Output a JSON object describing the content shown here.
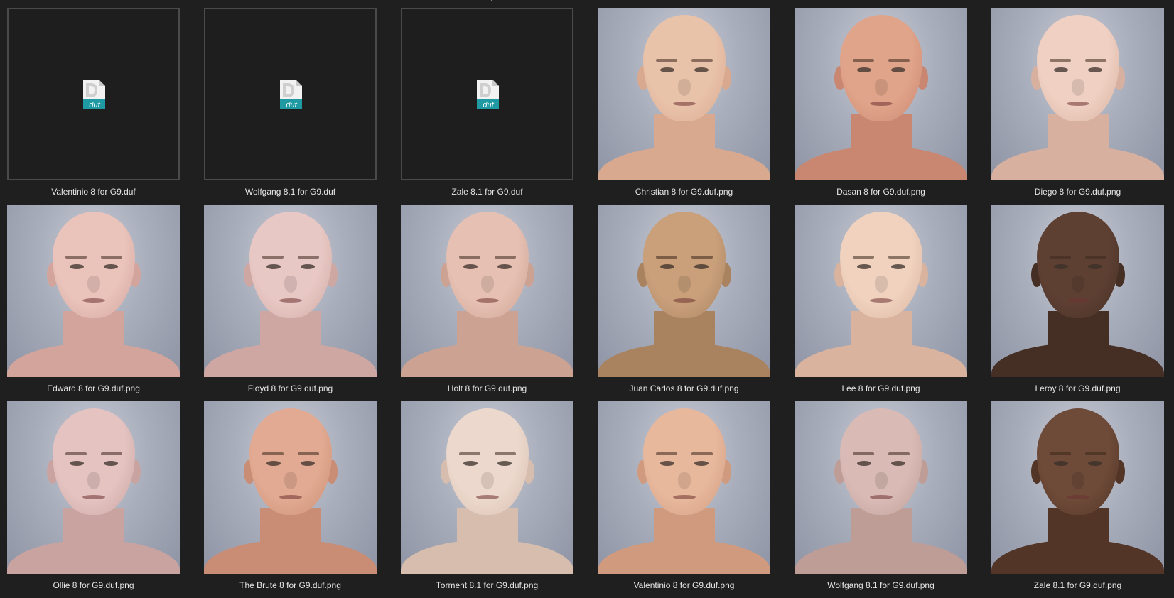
{
  "files": [
    {
      "name": "Valentinio 8 for G9.duf",
      "type": "duf",
      "icon": "duf-file-icon",
      "icon_text": "duf"
    },
    {
      "name": "Wolfgang 8.1 for G9.duf",
      "type": "duf",
      "icon": "duf-file-icon",
      "icon_text": "duf"
    },
    {
      "name": "Zale 8.1 for G9.duf",
      "type": "duf",
      "icon": "duf-file-icon",
      "icon_text": "duf"
    },
    {
      "name": "Christian 8 for G9.duf.png",
      "type": "png",
      "skin": "#e9c2aa",
      "shade": "#d9a98f"
    },
    {
      "name": "Dasan 8 for G9.duf.png",
      "type": "png",
      "skin": "#e0a48a",
      "shade": "#c98670"
    },
    {
      "name": "Diego 8 for G9.duf.png",
      "type": "png",
      "skin": "#efd0c2",
      "shade": "#d8b0a0"
    },
    {
      "name": "Edward 8 for G9.duf.png",
      "type": "png",
      "skin": "#eac3bb",
      "shade": "#d2a49c"
    },
    {
      "name": "Floyd 8 for G9.duf.png",
      "type": "png",
      "skin": "#e8c8c4",
      "shade": "#cfa7a2"
    },
    {
      "name": "Holt 8 for G9.duf.png",
      "type": "png",
      "skin": "#e6c0b2",
      "shade": "#cca292"
    },
    {
      "name": "Juan Carlos 8 for G9.duf.png",
      "type": "png",
      "skin": "#c9a07a",
      "shade": "#a98260"
    },
    {
      "name": "Lee 8 for G9.duf.png",
      "type": "png",
      "skin": "#f0d2bf",
      "shade": "#d9b39d"
    },
    {
      "name": "Leroy 8 for G9.duf.png",
      "type": "png",
      "skin": "#5e4033",
      "shade": "#452e24"
    },
    {
      "name": "Ollie 8 for G9.duf.png",
      "type": "png",
      "skin": "#e4c3c0",
      "shade": "#c9a3a0"
    },
    {
      "name": "The Brute 8 for G9.duf.png",
      "type": "png",
      "skin": "#e2aa92",
      "shade": "#c98c74"
    },
    {
      "name": "Torment 8.1 for G9.duf.png",
      "type": "png",
      "skin": "#ecd8cc",
      "shade": "#d6bdae"
    },
    {
      "name": "Valentinio 8 for G9.duf.png",
      "type": "png",
      "skin": "#e8b89c",
      "shade": "#d09a7e"
    },
    {
      "name": "Wolfgang 8.1 for G9.duf.png",
      "type": "png",
      "skin": "#d9bab4",
      "shade": "#bf9d97"
    },
    {
      "name": "Zale 8.1 for G9.duf.png",
      "type": "png",
      "skin": "#6e4a38",
      "shade": "#523526"
    }
  ],
  "colors": {
    "background": "#1f1f1f",
    "label_text": "#e6e6e6",
    "duf_teal": "#1f9aa3",
    "duf_page": "#f2f2f2"
  }
}
